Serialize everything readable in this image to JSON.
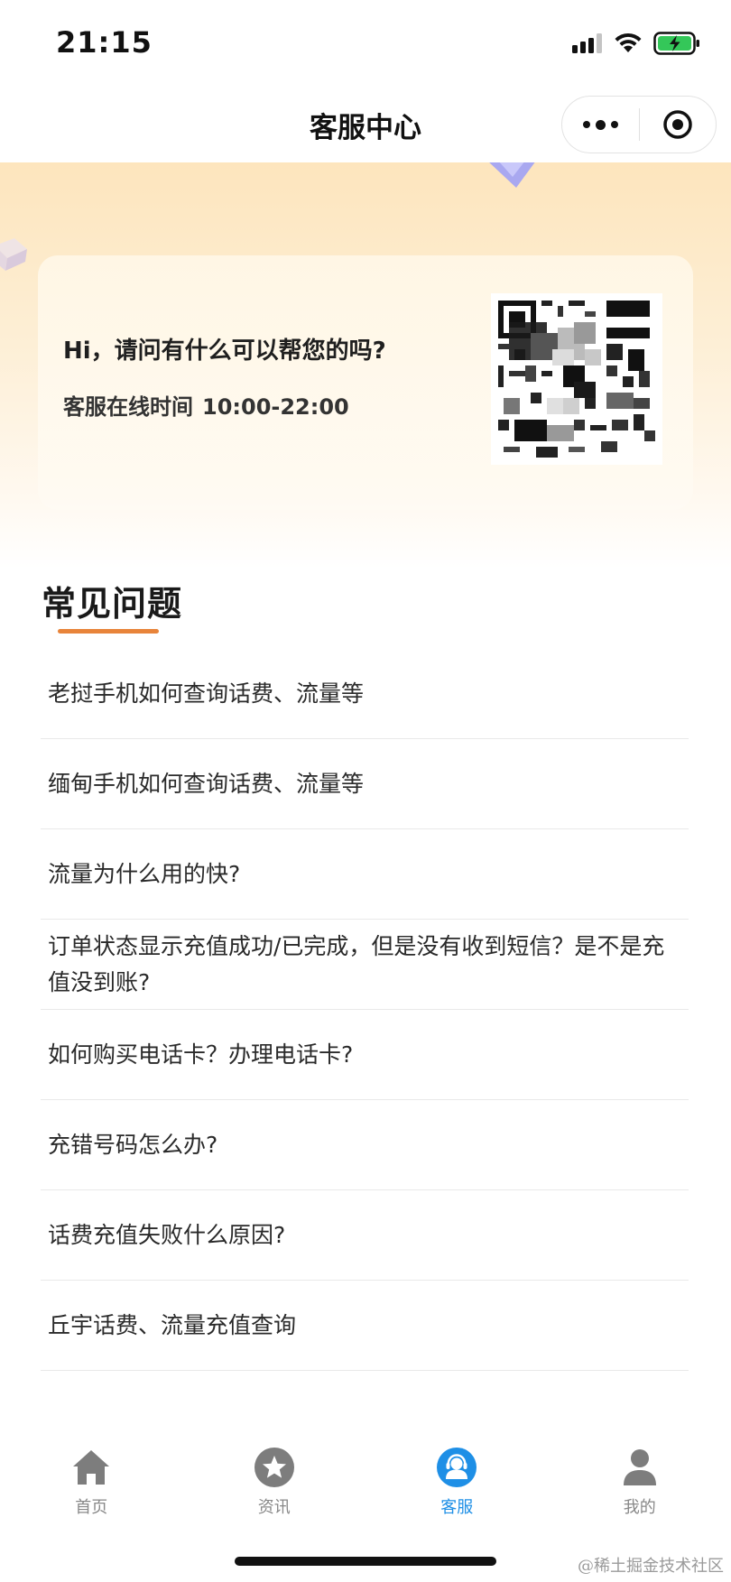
{
  "status_bar": {
    "time": "21:15",
    "signal_icon": "signal-bars-icon",
    "wifi_icon": "wifi-icon",
    "battery_icon": "battery-charging-icon",
    "battery_color": "#34c759"
  },
  "nav": {
    "title": "客服中心",
    "more_icon": "more-dots-icon",
    "close_icon": "target-circle-icon"
  },
  "hero": {
    "greeting": "Hi，请问有什么可以帮您的吗?",
    "hours_label": "客服在线时间",
    "hours_value": "10:00-22:00",
    "qr_icon": "qr-code-image"
  },
  "faq": {
    "title": "常见问题",
    "accent_color": "#e8843a",
    "items": [
      "老挝手机如何查询话费、流量等",
      "缅甸手机如何查询话费、流量等",
      "流量为什么用的快?",
      "订单状态显示充值成功/已完成，但是没有收到短信？是不是充值没到账?",
      "如何购买电话卡？办理电话卡?",
      "充错号码怎么办?",
      "话费充值失败什么原因?",
      "丘宇话费、流量充值查询"
    ]
  },
  "tabbar": {
    "active_color": "#1e8fe6",
    "items": [
      {
        "label": "首页",
        "icon": "home-icon"
      },
      {
        "label": "资讯",
        "icon": "star-icon"
      },
      {
        "label": "客服",
        "icon": "customer-service-icon"
      },
      {
        "label": "我的",
        "icon": "user-icon"
      }
    ],
    "active_index": 2
  },
  "watermark": "@稀土掘金技术社区"
}
